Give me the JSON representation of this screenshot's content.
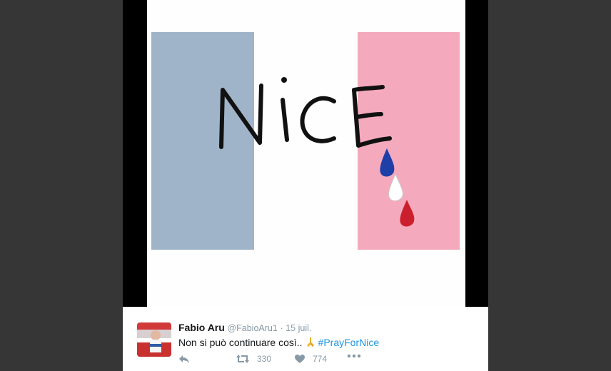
{
  "tweet": {
    "author_name": "Fabio Aru",
    "handle": "@FabioAru1",
    "separator": "·",
    "date": "15 juil.",
    "text": "Non si può continuare così..",
    "hashtag": "#PrayForNice",
    "retweet_count": "330",
    "like_count": "774"
  },
  "media": {
    "word": "NiCE",
    "colors": {
      "left_band": "#9fb4c8",
      "right_band": "#f5a9bc",
      "drop_blue": "#1f3fa8",
      "drop_white": "#ffffff",
      "drop_red": "#cc1f2e"
    }
  },
  "icons": {
    "reply": "reply-icon",
    "retweet": "retweet-icon",
    "like": "heart-icon",
    "more": "more-icon",
    "emoji": "praying-hands-icon"
  }
}
